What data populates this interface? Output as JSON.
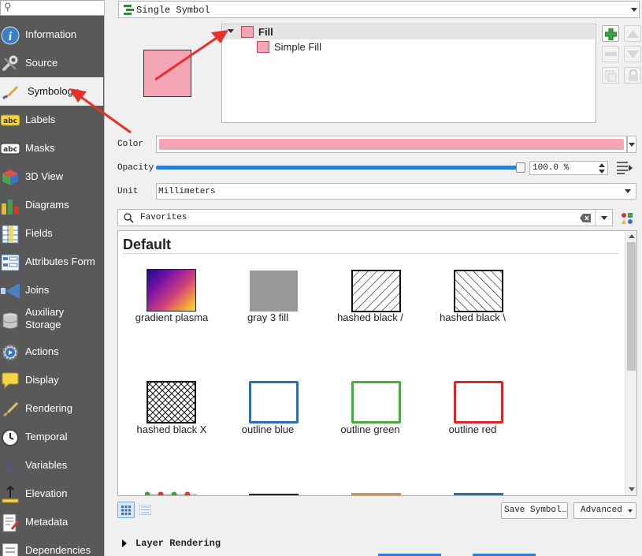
{
  "sidebar": {
    "search_icon": "search-icon",
    "items": [
      {
        "label": "Information",
        "icon": "info-icon"
      },
      {
        "label": "Source",
        "icon": "wrench-icon"
      },
      {
        "label": "Symbology",
        "icon": "paintbrush-icon"
      },
      {
        "label": "Labels",
        "icon": "abc-label-icon"
      },
      {
        "label": "Masks",
        "icon": "abc-mask-icon"
      },
      {
        "label": "3D View",
        "icon": "cube-icon"
      },
      {
        "label": "Diagrams",
        "icon": "diagram-icon"
      },
      {
        "label": "Fields",
        "icon": "fields-icon"
      },
      {
        "label": "Attributes Form",
        "icon": "form-icon"
      },
      {
        "label": "Joins",
        "icon": "join-icon"
      },
      {
        "label": "Auxiliary",
        "label2": "Storage",
        "icon": "database-icon"
      },
      {
        "label": "Actions",
        "icon": "gear-play-icon"
      },
      {
        "label": "Display",
        "icon": "speech-bubble-icon"
      },
      {
        "label": "Rendering",
        "icon": "brush-icon"
      },
      {
        "label": "Temporal",
        "icon": "clock-icon"
      },
      {
        "label": "Variables",
        "icon": "epsilon-icon"
      },
      {
        "label": "Elevation",
        "icon": "elevation-icon"
      },
      {
        "label": "Metadata",
        "icon": "metadata-icon"
      },
      {
        "label": "Dependencies",
        "icon": "dependencies-icon"
      }
    ]
  },
  "renderer": {
    "value": "Single Symbol"
  },
  "symbol_tree": {
    "root": "Fill",
    "child": "Simple Fill"
  },
  "color_label": "Color",
  "color_hex": "#f4a6b4",
  "opacity": {
    "label": "Opacity",
    "value_text": "100.0 %",
    "value": 1.0
  },
  "unit": {
    "label": "Unit",
    "value": "Millimeters"
  },
  "library": {
    "search_value": "Favorites",
    "group": "Default",
    "symbols": [
      {
        "name": "gradient   plasma"
      },
      {
        "name": "gray 3 fill"
      },
      {
        "name": "hashed black /"
      },
      {
        "name": "hashed black \\"
      },
      {
        "name": "hashed black X"
      },
      {
        "name": "outline blue"
      },
      {
        "name": "outline green"
      },
      {
        "name": "outline red"
      }
    ]
  },
  "buttons": {
    "save_symbol": "Save Symbol…",
    "advanced": "Advanced"
  },
  "layer_rendering": "Layer Rendering",
  "colors": {
    "accent": "#2a7fd4",
    "annotation": "#e8302a",
    "outline_blue": "#2f6fae",
    "outline_green": "#4aaa44",
    "outline_red": "#d62a2a"
  }
}
